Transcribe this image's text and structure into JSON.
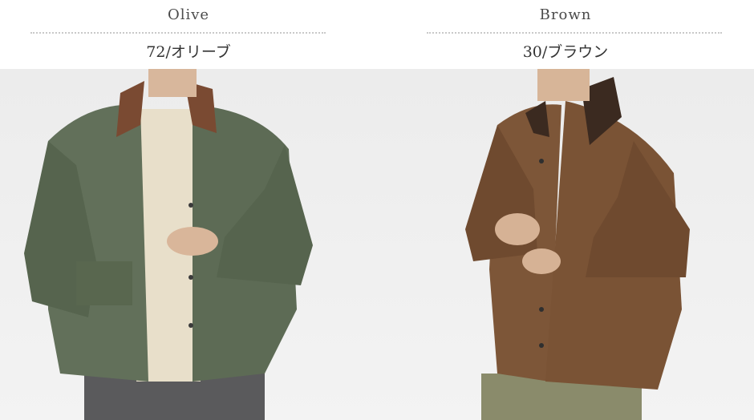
{
  "panels": [
    {
      "color_name_en": "Olive",
      "color_code_jp": "72/オリーブ",
      "photo_alt": "",
      "jacket_color": "#5f6f55"
    },
    {
      "color_name_en": "Brown",
      "color_code_jp": "30/ブラウン",
      "photo_alt": "",
      "jacket_color": "#7a5536"
    }
  ]
}
